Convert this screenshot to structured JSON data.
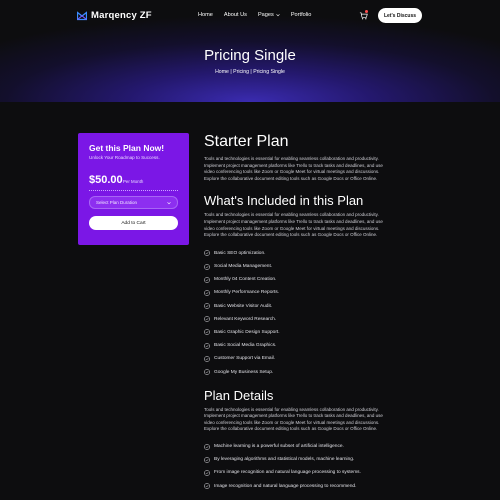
{
  "header": {
    "logo_text": "Marqency ZF",
    "nav": [
      "Home",
      "About Us",
      "Pages",
      "Portfolio"
    ],
    "cta": "Let's Discuss"
  },
  "hero": {
    "title": "Pricing Single",
    "breadcrumb": "Home | Pricing | Pricing Single"
  },
  "card": {
    "title": "Get this Plan Now!",
    "subtitle": "Unlock Your Roadmap to Success.",
    "price": "$50.00",
    "per": "Per Month",
    "select_placeholder": "Select Plan Duration",
    "button": "Add to Cart"
  },
  "main": {
    "plan_title": "Starter Plan",
    "plan_text": [
      "Tools and technologies is essential for enabling seamless collaboration and productivity.",
      "Implement project management platforms like Trello to track tasks and deadlines, and use",
      "video conferencing tools like Zoom or Google Meet for virtual meetings and discussions.",
      "Explore the collaborative document editing tools such as Google Docs or Office Online."
    ],
    "included_title": "What's Included in this Plan",
    "included_text": [
      "Tools and technologies is essential for enabling seamless collaboration and productivity.",
      "Implement project management platforms like Trello to track tasks and deadlines, and use",
      "video conferencing tools like Zoom or Google Meet for virtual meetings and discussions.",
      "Explore the collaborative document editing tools such as Google Docs or Office Online."
    ],
    "features": [
      "Basic SEO optimization.",
      "Social Media Management.",
      "Monthly 04 Content Creation.",
      "Monthly Performance Reports.",
      "Basic Website Visitor Audit.",
      "Relevant Keyword Research.",
      "Basic Graphic Design Support.",
      "Basic Social Media Graphics.",
      "Customer Support via Email.",
      "Google My Business Setup."
    ],
    "details_title": "Plan Details",
    "details_text": [
      "Tools and technologies is essential for enabling seamless collaboration and productivity.",
      "Implement project management platforms like Trello to track tasks and deadlines, and use",
      "video conferencing tools like Zoom or Google Meet for virtual meetings and discussions.",
      "Explore the collaborative document editing tools such as Google Docs or Office Online."
    ],
    "details_list": [
      "Machine learning is a powerful subset of artificial intelligence.",
      "By leveraging algorithms and statistical models, machine learning.",
      "From image recognition and natural language processing to systems.",
      "Image recognition and natural language processing to recommend."
    ]
  },
  "colors": {
    "accent": "#7b17e6",
    "background": "#0d0d0f",
    "hero_glow": "#3a2bb0"
  },
  "icons": {
    "logo": "logo-icon",
    "cart": "cart-icon",
    "check": "check-circle-icon",
    "caret": "chevron-down-icon"
  }
}
